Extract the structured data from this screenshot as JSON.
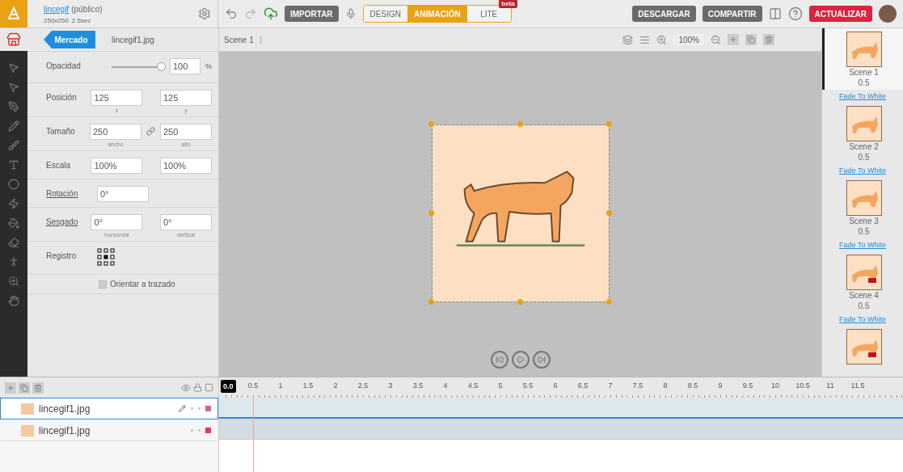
{
  "header": {
    "project": "lincegif",
    "visibility": "(público)",
    "size": "250x250",
    "duration": "2.5sec"
  },
  "toolbar": {
    "import": "IMPORTAR",
    "modes": [
      {
        "label": "DESIGN",
        "selected": false
      },
      {
        "label": "ANIMACIÓN",
        "selected": true
      },
      {
        "label": "LITE",
        "selected": false
      }
    ],
    "badge": "beta",
    "download": "DESCARGAR",
    "share": "COMPARTIR",
    "upgrade": "ACTUALIZAR"
  },
  "panel_tabs": {
    "market": "Mercado",
    "file": "lincegif1.jpg"
  },
  "properties": [
    {
      "kind": "slider",
      "label": "Opacidad",
      "level": 1,
      "value": "100",
      "unit": "%"
    },
    {
      "kind": "pair",
      "label": "Posición",
      "values": [
        "125",
        "125"
      ],
      "captions": [
        "x",
        "y"
      ]
    },
    {
      "kind": "pair",
      "label": "Tamaño",
      "values": [
        "250",
        "250"
      ],
      "captions": [
        "ancho",
        "alto"
      ],
      "linked": true
    },
    {
      "kind": "pair",
      "label": "Escala",
      "values": [
        "100%",
        "100%"
      ]
    },
    {
      "kind": "single",
      "label": "Rotación",
      "values": [
        "0°"
      ],
      "underlined": true
    },
    {
      "kind": "pair",
      "label": "Sesgado",
      "values": [
        "0°",
        "0°"
      ],
      "captions": [
        "horizontal",
        "vertical"
      ],
      "underlined": true
    },
    {
      "kind": "registration",
      "label": "Registro"
    },
    {
      "kind": "checkbox",
      "label": "Orientar a trazado",
      "checked": false
    }
  ],
  "canvas": {
    "breadcrumb": "Scene 1",
    "zoom": "100%"
  },
  "scenes": [
    {
      "name": "Scene 1",
      "duration": "0.5",
      "transition": "Fade To White",
      "selected": true
    },
    {
      "name": "Scene 2",
      "duration": "0.5",
      "transition": "Fade To White",
      "selected": false
    },
    {
      "name": "Scene 3",
      "duration": "0.5",
      "transition": "Fade To White",
      "selected": false
    },
    {
      "name": "Scene 4",
      "duration": "0.5",
      "transition": "Fade To White",
      "selected": false
    },
    {
      "selected": false
    }
  ],
  "layers": [
    {
      "name": "lincegif1.jpg",
      "selected": true,
      "color": "#d8609a"
    },
    {
      "name": "lincegif1.jpg",
      "selected": false,
      "color": "#e8336a"
    }
  ],
  "timeline": {
    "playhead": "0.0",
    "ticks": [
      "0.5",
      "1",
      "1.5",
      "2",
      "2.5",
      "3",
      "3.5",
      "4",
      "4.5",
      "5",
      "5.5",
      "6",
      "6.5",
      "7",
      "7.5",
      "8",
      "8.5",
      "9",
      "9.5",
      "10",
      "10.5",
      "11",
      "11.5"
    ]
  }
}
